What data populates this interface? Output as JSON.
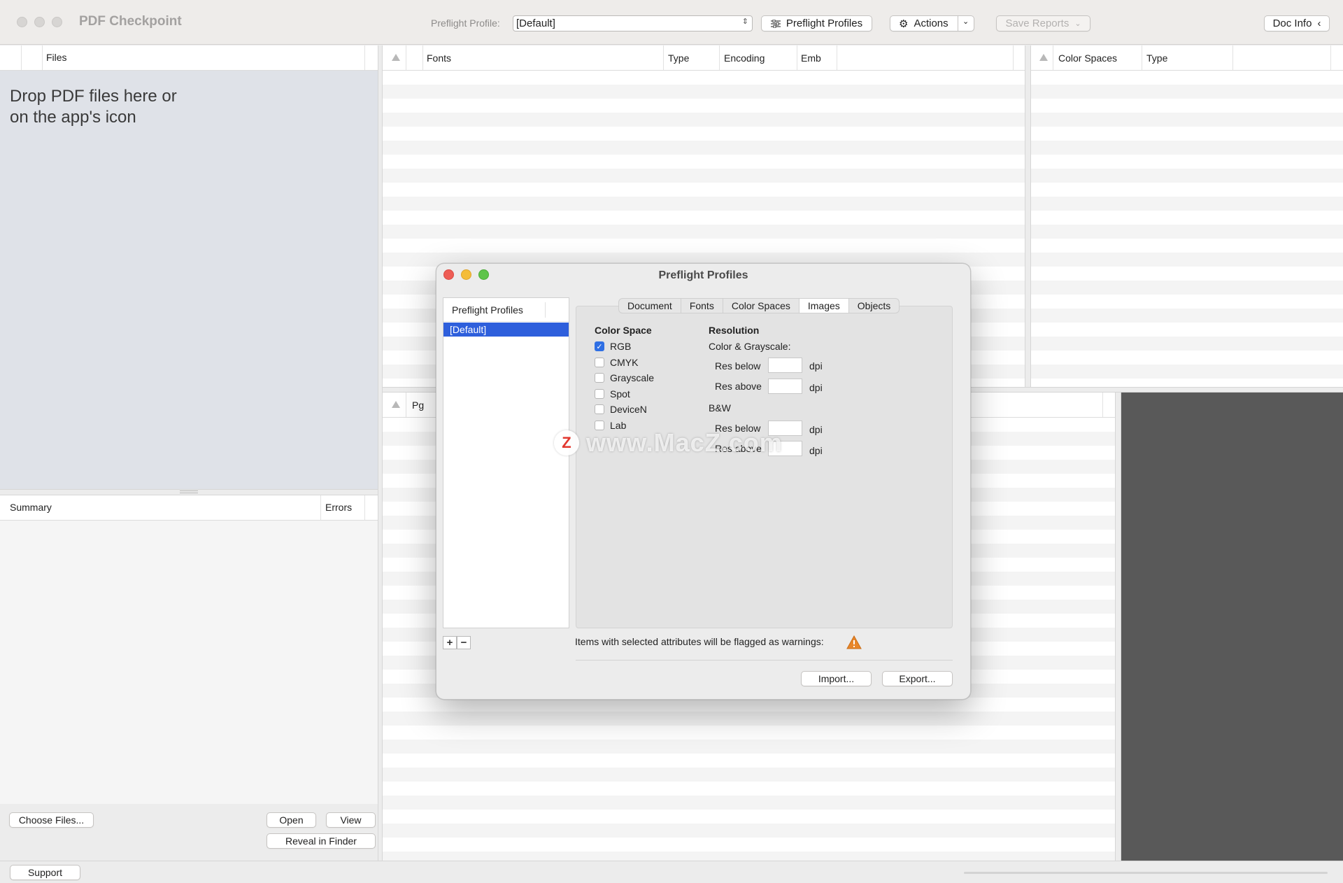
{
  "window": {
    "app_title": "PDF Checkpoint",
    "preflight_label": "Preflight Profile:",
    "preflight_value": "[Default]",
    "preflight_profiles_btn": "Preflight Profiles",
    "actions_btn": "Actions",
    "save_reports_btn": "Save Reports",
    "doc_info_btn": "Doc Info"
  },
  "files_pane": {
    "header": "Files",
    "drop_hint_line1": "Drop PDF files here or",
    "drop_hint_line2": "on the app's icon"
  },
  "summary_pane": {
    "col_summary": "Summary",
    "col_errors": "Errors"
  },
  "fonts_table": {
    "columns": [
      "Fonts",
      "Type",
      "Encoding",
      "Emb"
    ]
  },
  "color_table": {
    "columns": [
      "Color Spaces",
      "Type"
    ]
  },
  "pages_table": {
    "col_pg": "Pg"
  },
  "bottom_buttons": {
    "choose_files": "Choose Files...",
    "open": "Open",
    "view": "View",
    "reveal": "Reveal in Finder",
    "support": "Support"
  },
  "dialog": {
    "title": "Preflight Profiles",
    "list_header": "Preflight Profiles",
    "selected_profile": "[Default]",
    "tabs": [
      "Document",
      "Fonts",
      "Color Spaces",
      "Images",
      "Objects"
    ],
    "active_tab": "Images",
    "color_space_title": "Color Space",
    "color_spaces": [
      {
        "label": "RGB",
        "checked": true
      },
      {
        "label": "CMYK",
        "checked": false
      },
      {
        "label": "Grayscale",
        "checked": false
      },
      {
        "label": "Spot",
        "checked": false
      },
      {
        "label": "DeviceN",
        "checked": false
      },
      {
        "label": "Lab",
        "checked": false
      }
    ],
    "resolution_title": "Resolution",
    "color_grayscale_label": "Color & Grayscale:",
    "bw_label": "B&W",
    "res_below": "Res below",
    "res_above": "Res above",
    "dpi": "dpi",
    "warning_text": "Items with selected attributes will be flagged as warnings:",
    "import_btn": "Import...",
    "export_btn": "Export...",
    "add_symbol": "+",
    "remove_symbol": "−"
  },
  "watermark": {
    "logo_letter": "Z",
    "text": "www.MacZ.com"
  },
  "colors": {
    "accent": "#2f6fe4",
    "selection": "#2e5fdc",
    "warning": "#e8862a",
    "close": "#ee5d55",
    "minimize": "#f4bd3a",
    "zoom": "#5ec44a",
    "preview_dark": "#595959",
    "files_pane_bg": "#dfe2e8"
  }
}
